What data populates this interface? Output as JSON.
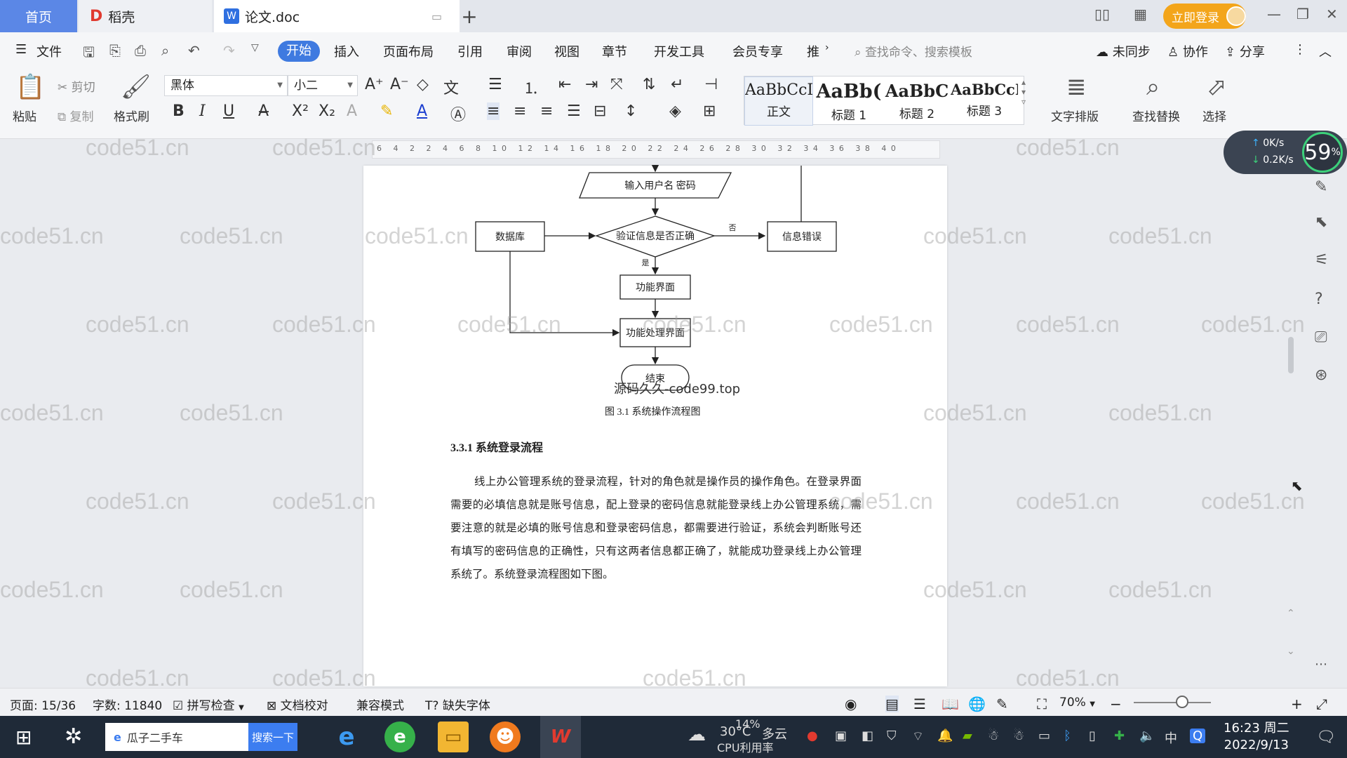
{
  "tabs": {
    "home": "首页",
    "draft": "稻壳",
    "doc": "论文.doc"
  },
  "titlebar": {
    "login": "立即登录"
  },
  "menu": {
    "file": "文件",
    "items": [
      "开始",
      "插入",
      "页面布局",
      "引用",
      "审阅",
      "视图",
      "章节",
      "开发工具",
      "会员专享",
      "推"
    ],
    "search_cmd": "查找命令、搜索模板",
    "sync": "未同步",
    "collab": "协作",
    "share": "分享"
  },
  "ribbon": {
    "paste": "粘贴",
    "cut": "剪切",
    "copy": "复制",
    "format_painter": "格式刷",
    "font_name": "黑体",
    "font_size": "小二",
    "styles": [
      {
        "sample": "AaBbCcDd",
        "name": "正文"
      },
      {
        "sample": "AaBb(",
        "name": "标题 1"
      },
      {
        "sample": "AaBbC",
        "name": "标题 2"
      },
      {
        "sample": "AaBbCcI",
        "name": "标题 3"
      }
    ],
    "text_layout": "文字排版",
    "find_replace": "查找替换",
    "select": "选择"
  },
  "ruler": {
    "marks": "6 4 2 2 4 6 8 10 12 14 16 18 20 22 24 26 28 30 32 34 36 38 40"
  },
  "flowchart": {
    "input": "输入用户名 密码",
    "database": "数据库",
    "verify": "验证信息是否正确",
    "error": "信息错误",
    "no": "否",
    "yes": "是",
    "func_ui": "功能界面",
    "func_proc": "功能处理界面",
    "end": "结束"
  },
  "document": {
    "source_caption": "源码久久-code99.top",
    "figure_caption": "图 3.1 系统操作流程图",
    "section_title": "3.3.1 系统登录流程",
    "paragraph": "线上办公管理系统的登录流程，针对的角色就是操作员的操作角色。在登录界面需要的必填信息就是账号信息，配上登录的密码信息就能登录线上办公管理系统，需要注意的就是必填的账号信息和登录密码信息，都需要进行验证，系统会判断账号还有填写的密码信息的正确性，只有这两者信息都正确了，就能成功登录线上办公管理系统了。系统登录流程图如下图。"
  },
  "watermark": "code51.cn",
  "speed_widget": {
    "up": "0K/s",
    "down": "0.2K/s",
    "percent": "59",
    "percent_unit": "%"
  },
  "status": {
    "page": "页面: 15/36",
    "words": "字数: 11840",
    "spell": "拼写检查",
    "proof": "文档校对",
    "compat": "兼容模式",
    "missing_font": "缺失字体",
    "zoom": "70%"
  },
  "taskbar": {
    "search_text": "瓜子二手车",
    "search_btn": "搜索一下",
    "weather_temp": "30°C",
    "weather_desc": "多云",
    "cpu_pct": "14%",
    "cpu_label": "CPU利用率",
    "ime": "中",
    "time": "16:23 周二",
    "date": "2022/9/13"
  },
  "colors": {
    "accent": "#3f7ae0",
    "login": "#f3a51b",
    "taskbar": "#1f2a38"
  }
}
